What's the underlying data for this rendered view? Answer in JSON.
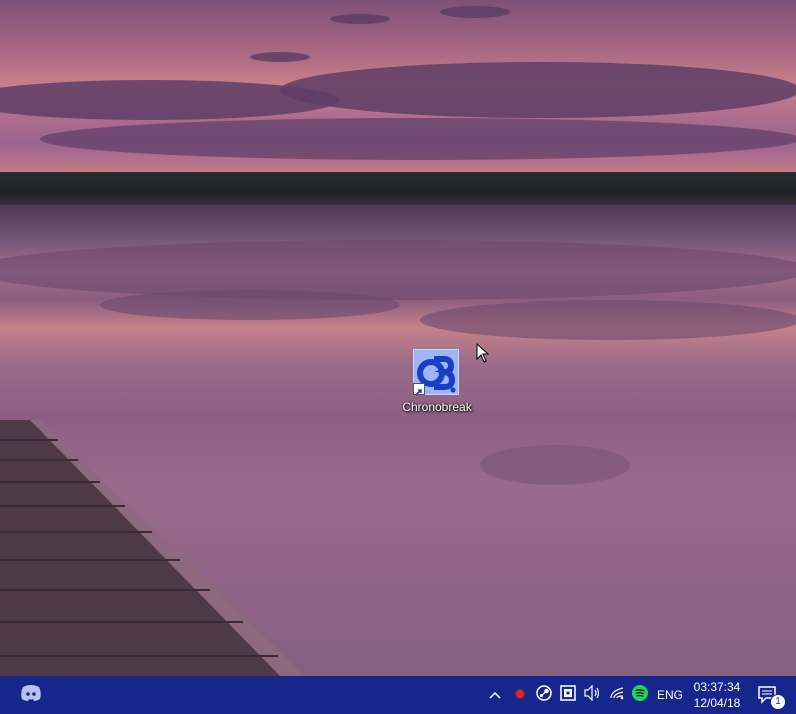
{
  "desktop": {
    "wallpaper": "lake-sunset-with-dock",
    "icons": [
      {
        "label": "Chronobreak",
        "icon": "chronobreak-app-icon",
        "shortcut": true
      }
    ]
  },
  "taskbar": {
    "color": "#16268c",
    "pinned": [
      {
        "icon": "discord-icon"
      }
    ],
    "tray": {
      "chevron_icon": "chevron-up-icon",
      "icons": [
        "record-icon",
        "steam-icon",
        "device-icon",
        "volume-icon",
        "wifi-icon",
        "spotify-icon"
      ],
      "language": "ENG",
      "time": "03:37:34",
      "date": "12/04/18",
      "notifications_count": "1"
    }
  }
}
